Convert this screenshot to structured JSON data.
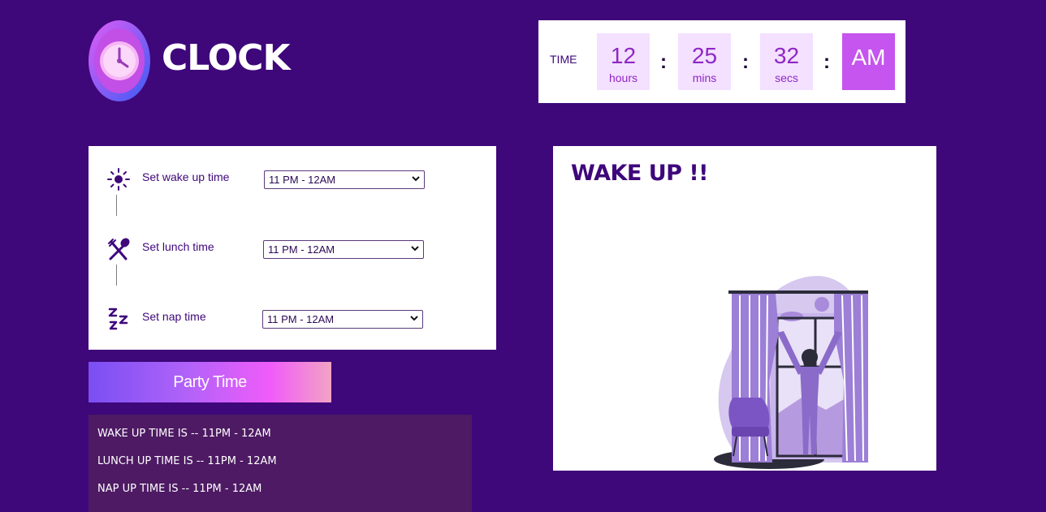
{
  "brand": {
    "name": "CLOCK",
    "icon": "alarm-clock-icon"
  },
  "clock": {
    "label": "TIME",
    "hours": "12",
    "hours_unit": "hours",
    "mins": "25",
    "mins_unit": "mins",
    "secs": "32",
    "secs_unit": "secs",
    "separator": ":",
    "period": "AM"
  },
  "settings": {
    "items": [
      {
        "label": "Set wake up time",
        "icon": "sun-icon",
        "value": "11 PM - 12AM"
      },
      {
        "label": "Set lunch time",
        "icon": "fork-spoon-icon",
        "value": "11 PM - 12AM"
      },
      {
        "label": "Set nap time",
        "icon": "sleep-zzz-icon",
        "value": "11 PM - 12AM"
      }
    ]
  },
  "party_button": {
    "label": "Party Time"
  },
  "summary": {
    "lines": [
      "WAKE UP TIME IS -- 11PM - 12AM",
      "LUNCH UP TIME IS -- 11PM - 12AM",
      "NAP UP TIME IS -- 11PM - 12AM"
    ]
  },
  "panel": {
    "heading": "WAKE UP !!",
    "image": "woman-opening-curtains-illustration"
  },
  "colors": {
    "background": "#3e077a",
    "accent": "#c555ee",
    "time_cell": "#f4e0ff",
    "summary_bg": "#4d1a63"
  }
}
